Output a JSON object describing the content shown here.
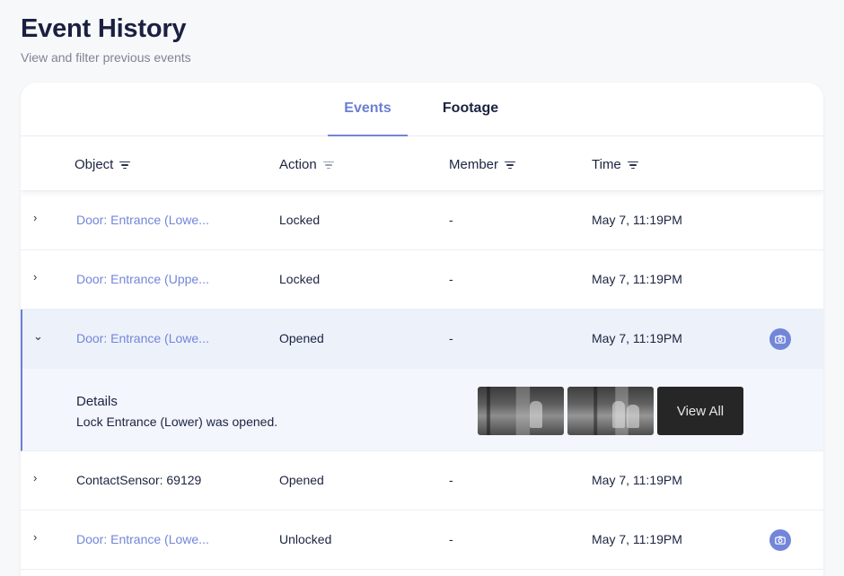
{
  "page": {
    "title": "Event History",
    "subtitle": "View and filter previous events"
  },
  "tabs": [
    {
      "label": "Events",
      "active": true
    },
    {
      "label": "Footage",
      "active": false
    }
  ],
  "columns": {
    "object": "Object",
    "action": "Action",
    "member": "Member",
    "time": "Time"
  },
  "rows": [
    {
      "object": "Door: Entrance (Lowe...",
      "action": "Locked",
      "member": "-",
      "time": "May 7, 11:19PM",
      "chevron": "›",
      "camera": false
    },
    {
      "object": "Door: Entrance (Uppe...",
      "action": "Locked",
      "member": "-",
      "time": "May 7, 11:19PM",
      "chevron": "›",
      "camera": false
    },
    {
      "object": "Door: Entrance (Lowe...",
      "action": "Opened",
      "member": "-",
      "time": "May 7, 11:19PM",
      "chevron": "⌄",
      "camera": true
    },
    {
      "object": "ContactSensor: 69129",
      "action": "Opened",
      "member": "-",
      "time": "May 7, 11:19PM",
      "chevron": "›",
      "camera": false
    },
    {
      "object": "Door: Entrance (Lowe...",
      "action": "Unlocked",
      "member": "-",
      "time": "May 7, 11:19PM",
      "chevron": "›",
      "camera": true
    }
  ],
  "details": {
    "label": "Details",
    "text": "Lock Entrance (Lower) was opened.",
    "view_all": "View All"
  },
  "icons": {
    "filter": "filter-icon",
    "camera": "camera-icon",
    "expand": "chevron-right-icon",
    "collapse": "chevron-down-icon"
  },
  "colors": {
    "accent": "#7286d9",
    "link": "#7286d9",
    "expanded_row": "#edf1fa"
  }
}
